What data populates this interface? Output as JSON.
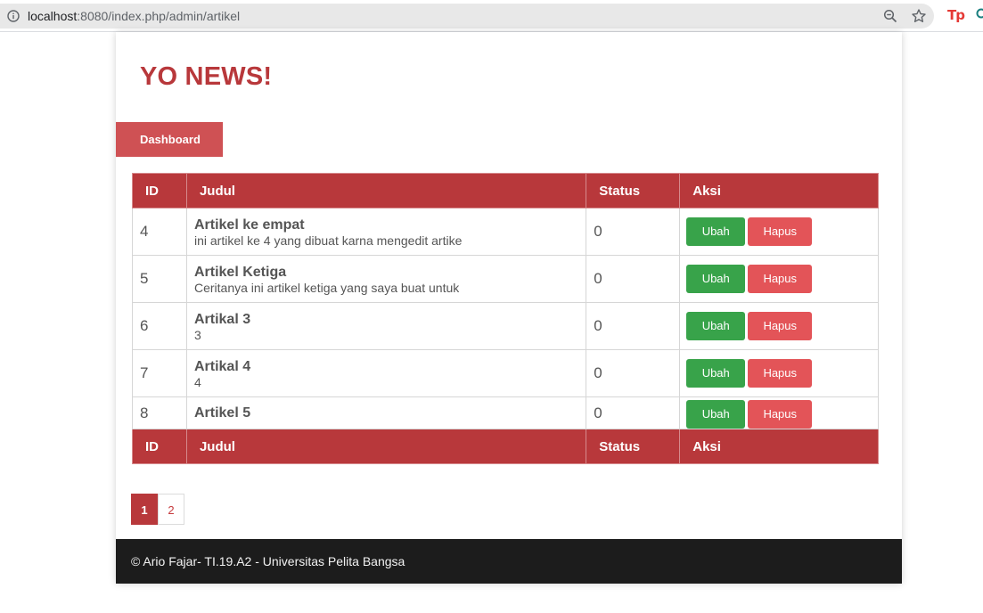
{
  "browser": {
    "url_host": "localhost",
    "url_rest": ":8080/index.php/admin/artikel",
    "extension_label": "Tp"
  },
  "site": {
    "brand": "YO NEWS!",
    "nav": {
      "dashboard": "Dashboard"
    }
  },
  "table": {
    "headers": {
      "id": "ID",
      "judul": "Judul",
      "status": "Status",
      "aksi": "Aksi"
    },
    "rows": [
      {
        "id": "4",
        "title": "Artikel ke empat",
        "desc": "ini artikel ke 4 yang dibuat karna mengedit artike",
        "status": "0"
      },
      {
        "id": "5",
        "title": "Artikel Ketiga",
        "desc": "Ceritanya ini artikel ketiga yang saya buat untuk",
        "status": "0"
      },
      {
        "id": "6",
        "title": "Artikal 3",
        "desc": "3",
        "status": "0"
      },
      {
        "id": "7",
        "title": "Artikal 4",
        "desc": "4",
        "status": "0"
      },
      {
        "id": "8",
        "title": "Artikel 5",
        "desc": "",
        "status": "0"
      }
    ],
    "actions": {
      "edit": "Ubah",
      "delete": "Hapus"
    }
  },
  "pagination": {
    "pages": [
      "1",
      "2"
    ],
    "active": "1"
  },
  "footer": {
    "text": "© Ario Fajar- TI.19.A2 - Universitas Pelita Bangsa"
  },
  "colors": {
    "brand": "#b8383b",
    "nav": "#cf5154",
    "edit_button": "#38a34a",
    "delete_button": "#e35458",
    "footer": "#1c1c1c"
  }
}
